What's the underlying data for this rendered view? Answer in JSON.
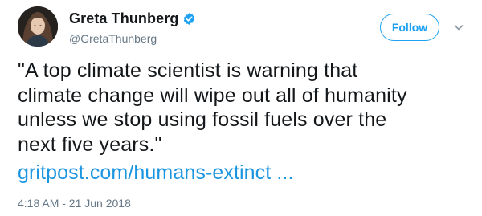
{
  "author": {
    "display_name": "Greta Thunberg",
    "handle": "@GretaThunberg",
    "verified": true,
    "verified_icon": "verified-badge-icon",
    "avatar": "profile-photo"
  },
  "actions": {
    "follow_label": "Follow",
    "more_icon": "chevron-down-icon"
  },
  "tweet": {
    "text_lines": [
      "\"A top climate scientist is warning that",
      "climate change will wipe out all of humanity",
      "unless we stop using fossil fuels over the",
      "next five years.\""
    ],
    "link_text": "gritpost.com/humans-extinct ...",
    "timestamp": "4:18 AM - 21 Jun 2018"
  },
  "colors": {
    "accent": "#1da1f2",
    "link": "#1b95e0",
    "text": "#14171a",
    "secondary": "#657786"
  }
}
